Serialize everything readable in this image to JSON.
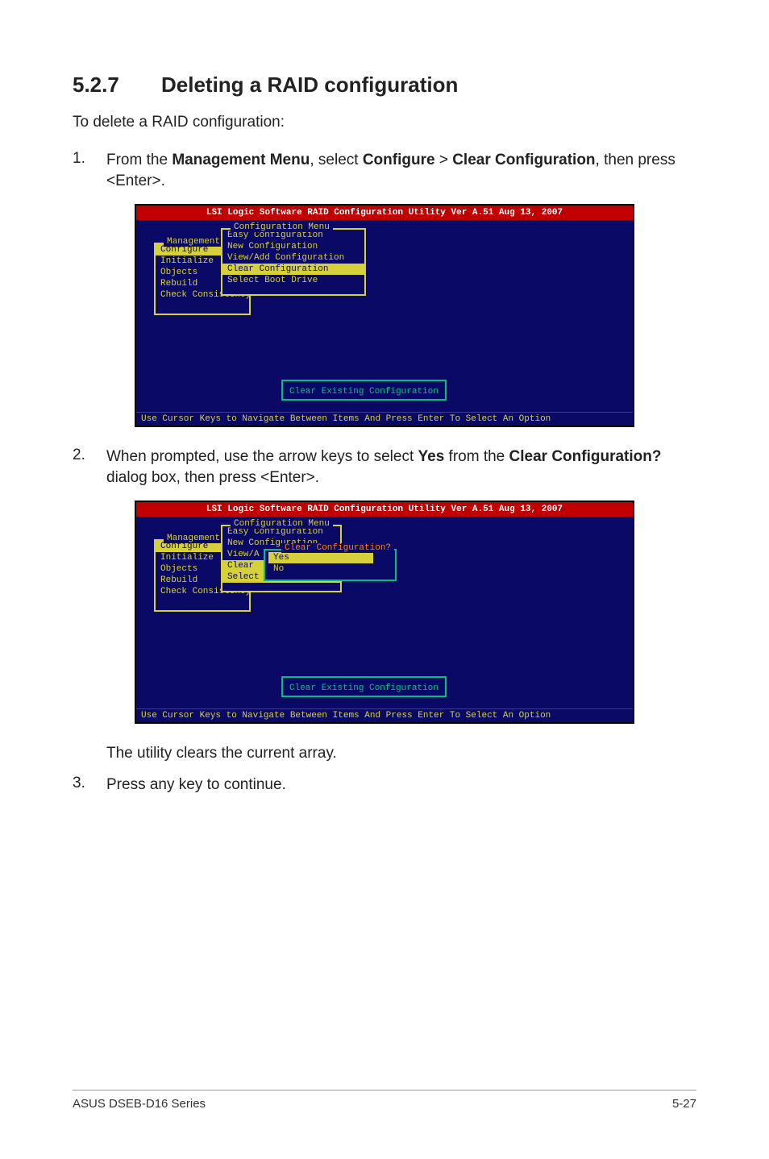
{
  "section": {
    "number": "5.2.7",
    "title": "Deleting a RAID configuration"
  },
  "intro": "To delete a RAID configuration:",
  "steps": [
    {
      "n": "1.",
      "pre": "From the ",
      "b1": "Management Menu",
      "mid1": ", select ",
      "b2": "Configure",
      "mid2": " > ",
      "b3": "Clear Configuration",
      "post": ", then press <Enter>."
    },
    {
      "n": "2.",
      "pre": "When prompted, use the arrow keys to select ",
      "b1": "Yes",
      "mid1": " from the ",
      "b2": "Clear Configuration?",
      "post": " dialog box, then press <Enter>."
    },
    {
      "n": "3.",
      "pre": "Press any key to continue."
    }
  ],
  "after_shot2": "The utility clears the current array.",
  "shot": {
    "title": "LSI Logic Software RAID Configuration Utility Ver A.51 Aug 13, 2007",
    "mgmt_title": "Management",
    "mgmt_items": [
      "Configure",
      "Initialize",
      "Objects",
      "Rebuild",
      "Check Consistency"
    ],
    "cfg_title": "Configuration Menu",
    "cfg_items": [
      "Easy Configuration",
      "New Configuration",
      "View/Add Configuration",
      "Clear Configuration",
      "Select Boot Drive"
    ],
    "status": "Clear Existing Configuration",
    "helpbar": "Use Cursor Keys to Navigate Between Items And Press Enter To Select An Option"
  },
  "shot2": {
    "cfg_items_trunc": [
      "Easy Configuration",
      "New Configuration",
      "View/A",
      "Clear",
      "Select"
    ],
    "dlg_title": "Clear Configuration?",
    "dlg_items": [
      "Yes",
      "No"
    ]
  },
  "footer": {
    "left": "ASUS DSEB-D16 Series",
    "right": "5-27"
  }
}
